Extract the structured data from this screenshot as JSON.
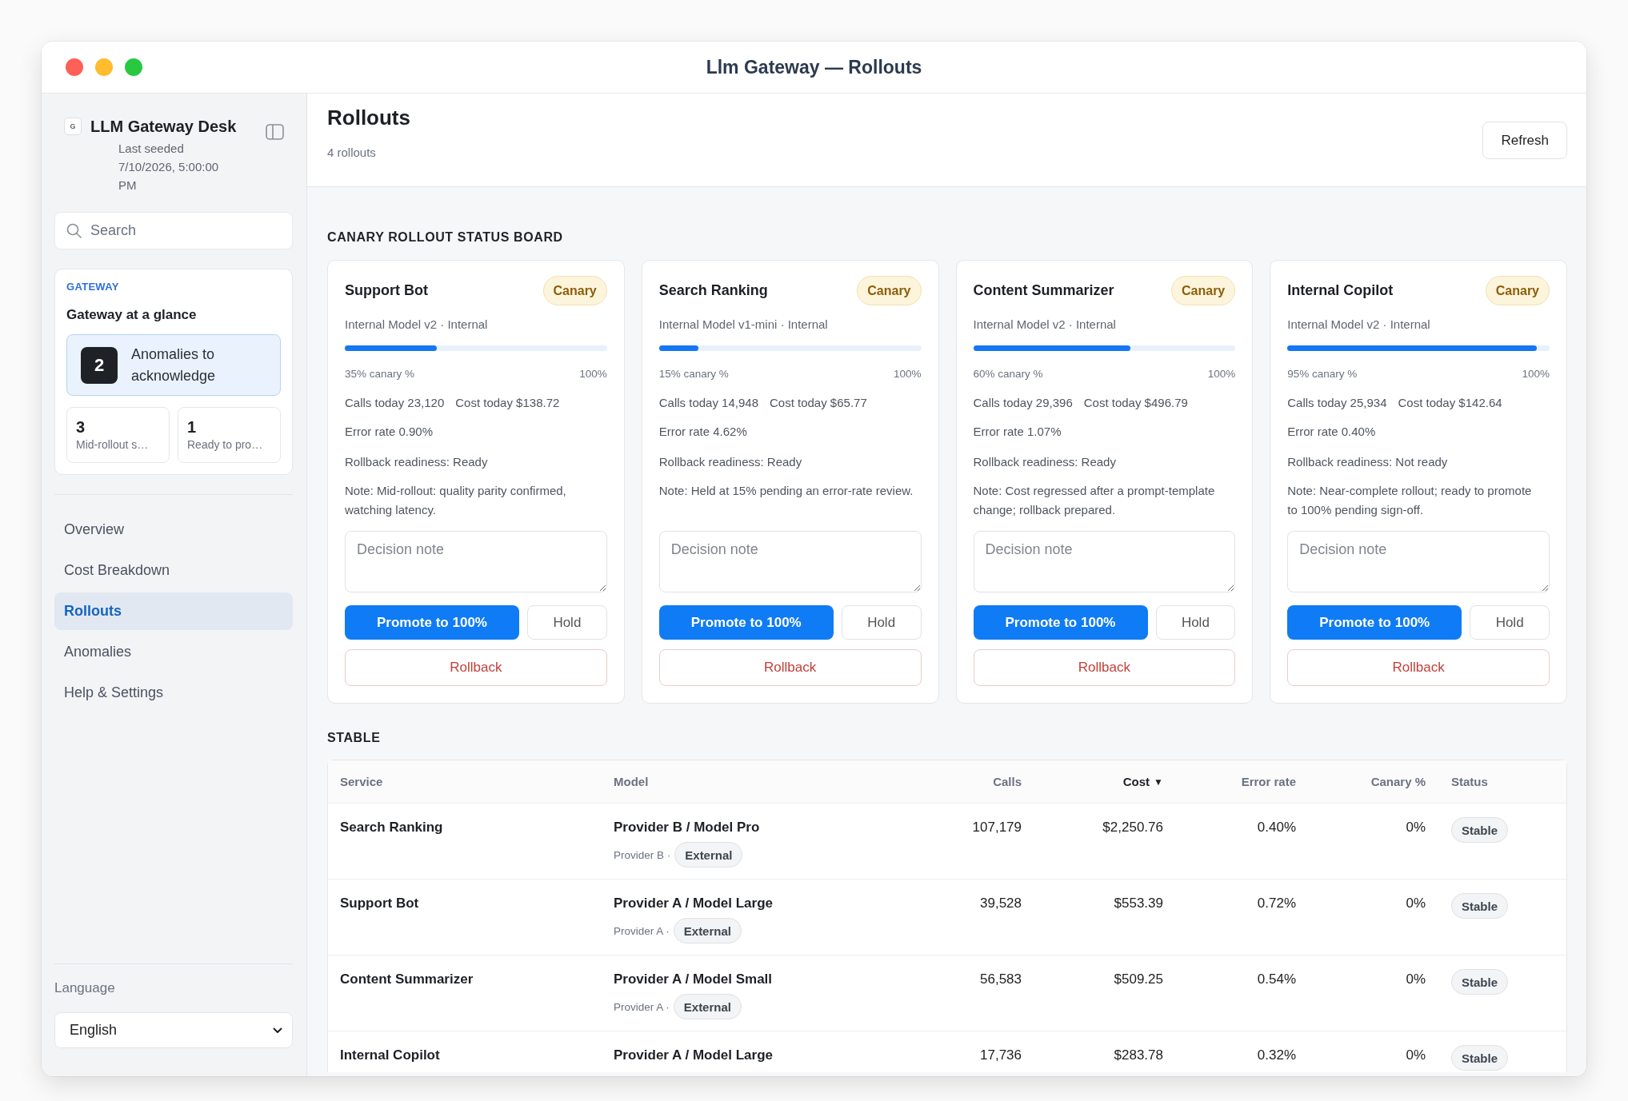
{
  "window": {
    "title": "Llm Gateway — Rollouts"
  },
  "sidebar": {
    "logo_letter": "G",
    "app_name": "LLM Gateway Desk",
    "seeded": "Last seeded 7/10/2026, 5:00:00 PM",
    "search": {
      "placeholder": "Search"
    },
    "glance": {
      "eyebrow": "GATEWAY",
      "title": "Gateway at a glance",
      "highlight": {
        "count": "2",
        "label": "Anomalies to acknowledge"
      },
      "stats": [
        {
          "value": "3",
          "label": "Mid-rollout s…"
        },
        {
          "value": "1",
          "label": "Ready to pro…"
        }
      ]
    },
    "nav": [
      {
        "label": "Overview",
        "selected": false
      },
      {
        "label": "Cost Breakdown",
        "selected": false
      },
      {
        "label": "Rollouts",
        "selected": true
      },
      {
        "label": "Anomalies",
        "selected": false
      },
      {
        "label": "Help & Settings",
        "selected": false
      }
    ],
    "language": {
      "label": "Language",
      "value": "English"
    }
  },
  "header": {
    "title": "Rollouts",
    "subtitle": "4 rollouts",
    "refresh_button": "Refresh"
  },
  "canary_board": {
    "heading": "CANARY ROLLOUT STATUS BOARD",
    "cards": [
      {
        "service": "Support Bot",
        "status": "Canary",
        "model": "Internal Model v2 · Internal",
        "level": 0.35,
        "canary_label": "35% canary %",
        "max_label": "100%",
        "calls": "Calls today 23,120",
        "cost": "Cost today $138.72",
        "error_rate": "Error rate 0.90%",
        "rollback_readiness": "Rollback readiness: Ready",
        "note": "Note: Mid-rollout: quality parity confirmed, watching latency.",
        "decision_note": {
          "placeholder": "Decision note"
        },
        "actions": {
          "promote": "Promote to 100%",
          "hold": "Hold",
          "rollback": "Rollback"
        }
      },
      {
        "service": "Search Ranking",
        "status": "Canary",
        "model": "Internal Model v1-mini · Internal",
        "level": 0.15,
        "canary_label": "15% canary %",
        "max_label": "100%",
        "calls": "Calls today 14,948",
        "cost": "Cost today $65.77",
        "error_rate": "Error rate 4.62%",
        "rollback_readiness": "Rollback readiness: Ready",
        "note": "Note: Held at 15% pending an error-rate review.",
        "decision_note": {
          "placeholder": "Decision note"
        },
        "actions": {
          "promote": "Promote to 100%",
          "hold": "Hold",
          "rollback": "Rollback"
        }
      },
      {
        "service": "Content Summarizer",
        "status": "Canary",
        "model": "Internal Model v2 · Internal",
        "level": 0.6,
        "canary_label": "60% canary %",
        "max_label": "100%",
        "calls": "Calls today 29,396",
        "cost": "Cost today $496.79",
        "error_rate": "Error rate 1.07%",
        "rollback_readiness": "Rollback readiness: Ready",
        "note": "Note: Cost regressed after a prompt-template change; rollback prepared.",
        "decision_note": {
          "placeholder": "Decision note"
        },
        "actions": {
          "promote": "Promote to 100%",
          "hold": "Hold",
          "rollback": "Rollback"
        }
      },
      {
        "service": "Internal Copilot",
        "status": "Canary",
        "model": "Internal Model v2 · Internal",
        "level": 0.95,
        "canary_label": "95% canary %",
        "max_label": "100%",
        "calls": "Calls today 25,934",
        "cost": "Cost today $142.64",
        "error_rate": "Error rate 0.40%",
        "rollback_readiness": "Rollback readiness: Not ready",
        "note": "Note: Near-complete rollout; ready to promote to 100% pending sign-off.",
        "decision_note": {
          "placeholder": "Decision note"
        },
        "actions": {
          "promote": "Promote to 100%",
          "hold": "Hold",
          "rollback": "Rollback"
        }
      }
    ]
  },
  "stable": {
    "heading": "STABLE",
    "table": {
      "columns": [
        {
          "label": "Service",
          "kind": "text",
          "sorted": false
        },
        {
          "label": "Model",
          "kind": "model",
          "sorted": false
        },
        {
          "label": "Calls",
          "kind": "number",
          "sorted": false
        },
        {
          "label": "Cost",
          "kind": "number",
          "sorted": true,
          "sort_indicator": "▼"
        },
        {
          "label": "Error rate",
          "kind": "number",
          "sorted": false
        },
        {
          "label": "Canary %",
          "kind": "number",
          "sorted": false
        },
        {
          "label": "Status",
          "kind": "status",
          "sorted": false
        }
      ],
      "rows": [
        {
          "service": "Search Ranking",
          "model": "Provider B / Model Pro",
          "provider": "Provider B ·",
          "tag": "External",
          "calls": "107,179",
          "cost": "$2,250.76",
          "error_rate": "0.40%",
          "canary": "0%",
          "status": "Stable"
        },
        {
          "service": "Support Bot",
          "model": "Provider A / Model Large",
          "provider": "Provider A ·",
          "tag": "External",
          "calls": "39,528",
          "cost": "$553.39",
          "error_rate": "0.72%",
          "canary": "0%",
          "status": "Stable"
        },
        {
          "service": "Content Summarizer",
          "model": "Provider A / Model Small",
          "provider": "Provider A ·",
          "tag": "External",
          "calls": "56,583",
          "cost": "$509.25",
          "error_rate": "0.54%",
          "canary": "0%",
          "status": "Stable"
        },
        {
          "service": "Internal Copilot",
          "model": "Provider A / Model Large",
          "calls": "17,736",
          "cost": "$283.78",
          "error_rate": "0.32%",
          "canary": "0%",
          "status": "Stable"
        }
      ]
    }
  }
}
